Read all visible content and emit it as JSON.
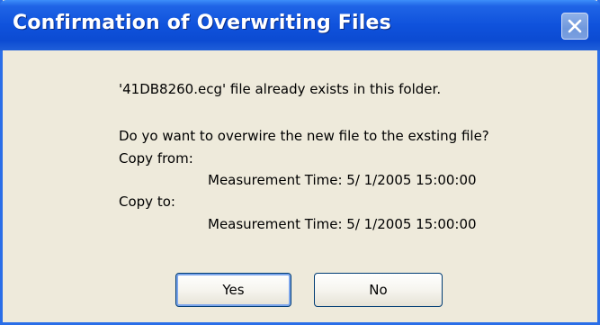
{
  "window": {
    "title": "Confirmation of Overwriting Files",
    "close_icon": "close-icon"
  },
  "message": {
    "line1": "'41DB8260.ecg' file already exists in this folder.",
    "question": "Do yo want to overwire the new file to the exsting file?",
    "copy_from_label": "Copy from:",
    "copy_from_value": "Measurement Time:  5/ 1/2005 15:00:00",
    "copy_to_label": "Copy to:",
    "copy_to_value": "Measurement Time:  5/ 1/2005 15:00:00"
  },
  "buttons": {
    "yes_label": "Yes",
    "no_label": "No"
  },
  "colors": {
    "titlebar": "#0f52dc",
    "dialog_bg": "#eeeadb",
    "close_button": "#7098dc"
  }
}
